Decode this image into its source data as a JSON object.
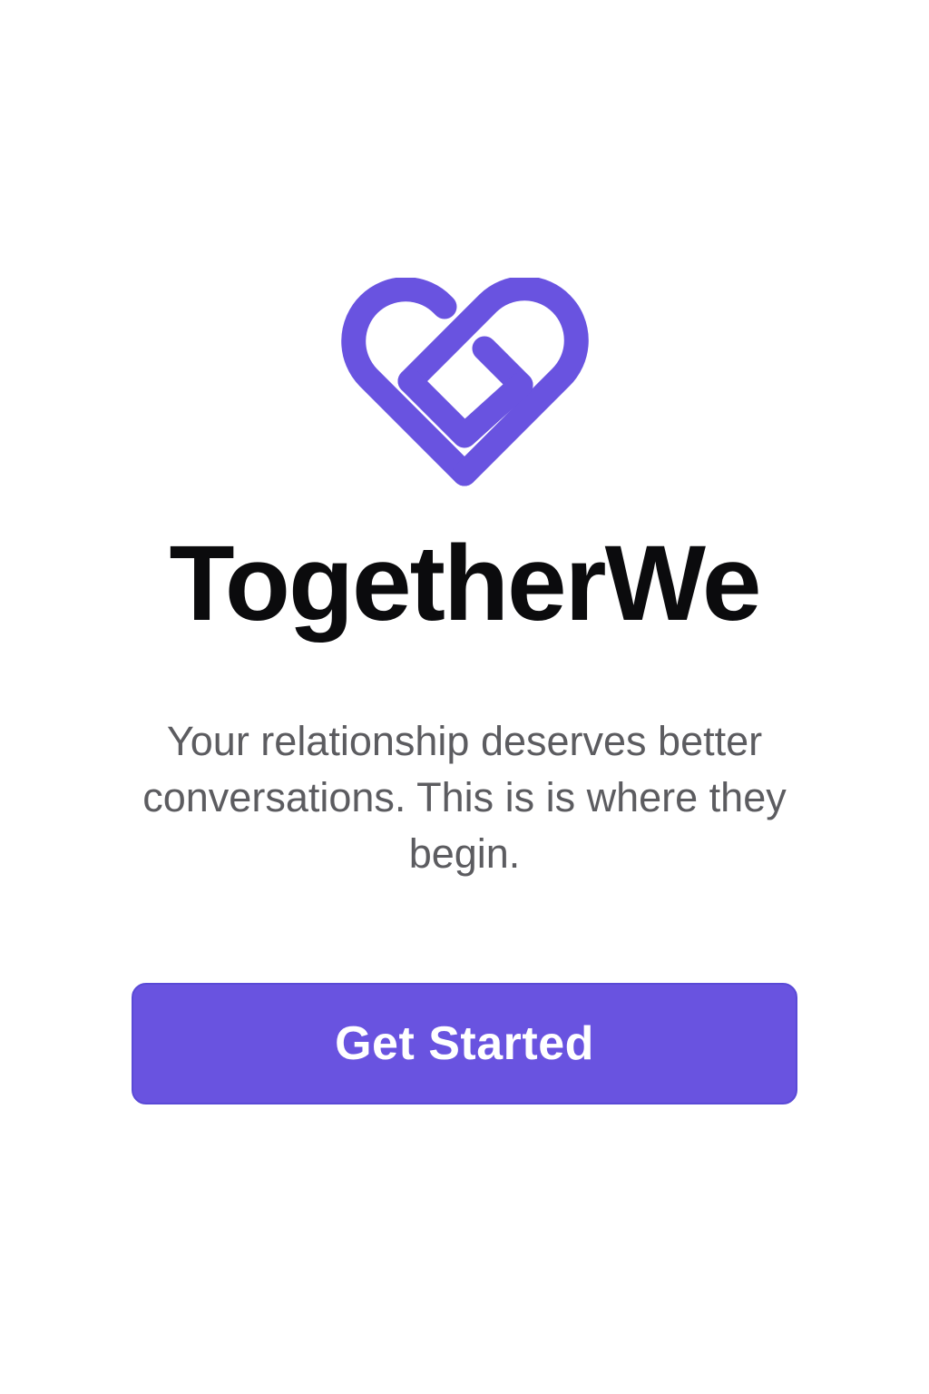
{
  "brand": {
    "logo_icon": "heart-logo-icon",
    "app_name": "TogetherWe",
    "accent_color": "#6953E0"
  },
  "intro": {
    "tagline": "Your relationship deserves better conversations. This is is where they begin."
  },
  "actions": {
    "get_started_label": "Get Started"
  }
}
